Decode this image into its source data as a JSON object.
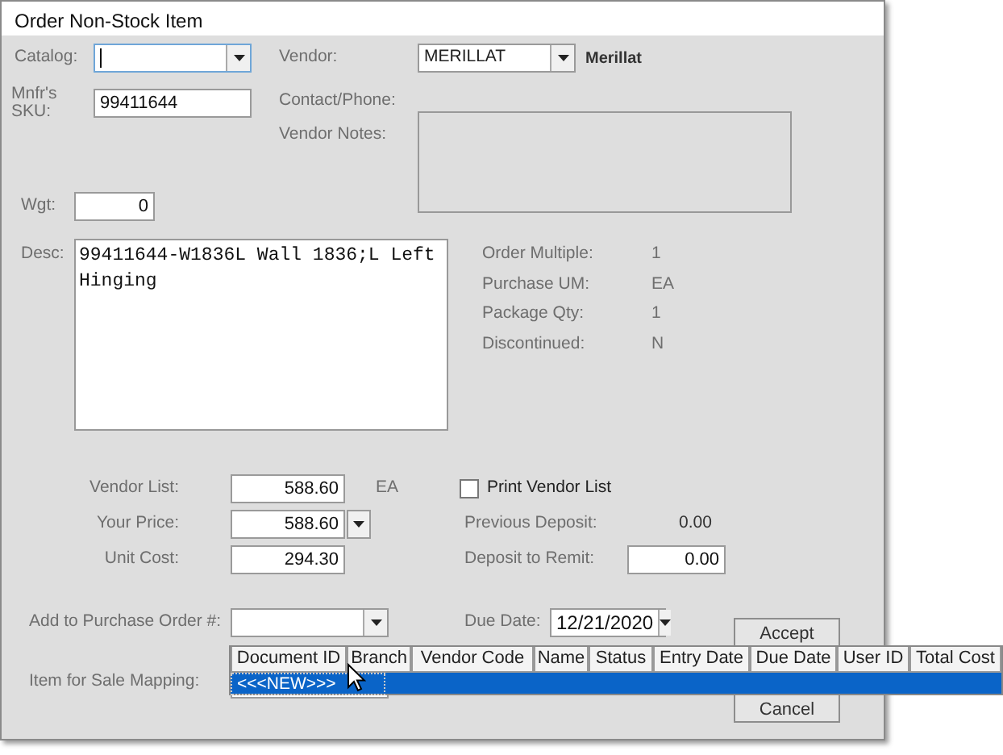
{
  "window": {
    "title": "Order Non-Stock Item"
  },
  "catalog": {
    "label": "Catalog:",
    "focused": true
  },
  "vendor": {
    "label": "Vendor:",
    "value": "MERILLAT",
    "name": "Merillat"
  },
  "sku": {
    "label": "Mnfr's SKU:",
    "value": "99411644"
  },
  "contact": {
    "label": "Contact/Phone:"
  },
  "vendor_notes": {
    "label": "Vendor Notes:"
  },
  "weight": {
    "label": "Wgt:",
    "value": "0"
  },
  "description": {
    "label": "Desc:",
    "value": "99411644-W1836L Wall 1836;L Left Hinging"
  },
  "info": [
    {
      "label": "Order Multiple:",
      "value": "1"
    },
    {
      "label": "Purchase UM:",
      "value": "EA"
    },
    {
      "label": "Package Qty:",
      "value": "1"
    },
    {
      "label": "Discontinued:",
      "value": "N"
    }
  ],
  "vendor_list": {
    "label": "Vendor List:",
    "value": "588.60",
    "unit": "EA"
  },
  "your_price": {
    "label": "Your Price:",
    "value": "588.60"
  },
  "unit_cost": {
    "label": "Unit Cost:",
    "value": "294.30"
  },
  "print_vendor_list": {
    "label": "Print Vendor List",
    "checked": false
  },
  "previous_deposit": {
    "label": "Previous Deposit:",
    "value": "0.00"
  },
  "deposit_to_remit": {
    "label": "Deposit to Remit:",
    "value": "0.00"
  },
  "purchase_order": {
    "label": "Add to Purchase Order #:"
  },
  "due_date": {
    "label": "Due Date:",
    "value": "12/21/2020"
  },
  "sale_mapping": {
    "label": "Item for Sale Mapping:"
  },
  "po_dropdown": {
    "columns": [
      "Document ID",
      "Branch",
      "Vendor Code",
      "Name",
      "Status",
      "Entry Date",
      "Due Date",
      "User ID",
      "Total Cost"
    ],
    "rows": [
      {
        "cells": [
          "<<<NEW>>>"
        ],
        "selected": true
      }
    ]
  },
  "buttons": [
    "Accept",
    "Cancel"
  ]
}
